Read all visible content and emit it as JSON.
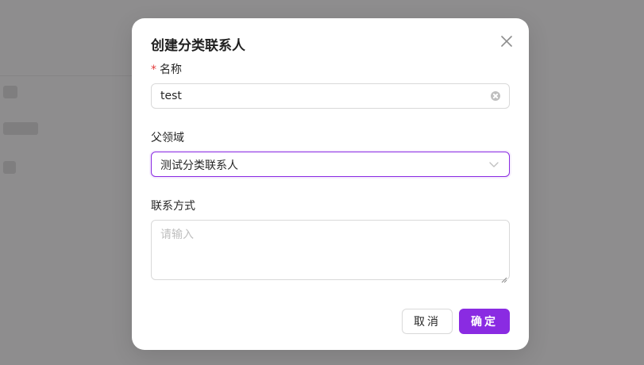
{
  "dialog": {
    "title": "创建分类联系人",
    "close_icon": "close-icon"
  },
  "form": {
    "name": {
      "label": "名称",
      "required_mark": "*",
      "value": "test",
      "clear_icon": "clear-circle-icon"
    },
    "parent": {
      "label": "父领域",
      "selected": "测试分类联系人",
      "dropdown_icon": "chevron-down-icon"
    },
    "contact": {
      "label": "联系方式",
      "placeholder": "请输入",
      "value": ""
    }
  },
  "footer": {
    "cancel_label": "取消",
    "ok_label": "确定"
  },
  "colors": {
    "accent": "#8a2be2",
    "required": "#e23b3b",
    "overlay": "#8e8d8e"
  }
}
